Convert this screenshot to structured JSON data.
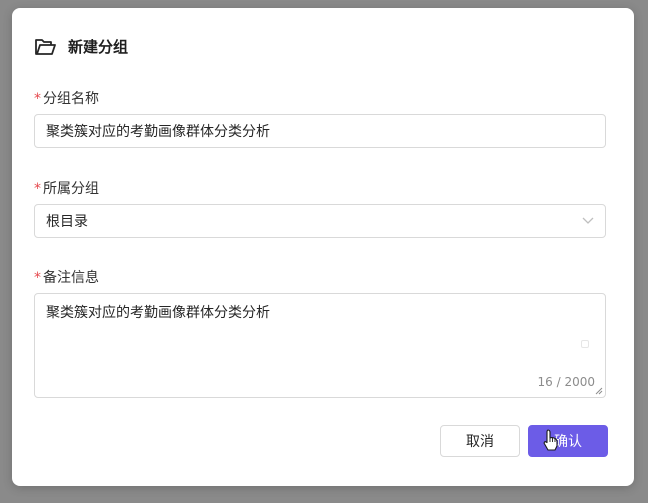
{
  "dialog": {
    "title": "新建分组",
    "title_icon": "folder-open-icon"
  },
  "fields": {
    "name": {
      "required_mark": "*",
      "label": "分组名称",
      "value": "聚类簇对应的考勤画像群体分类分析"
    },
    "parent": {
      "required_mark": "*",
      "label": "所属分组",
      "value": "根目录",
      "icon": "chevron-down-icon"
    },
    "remark": {
      "required_mark": "*",
      "label": "备注信息",
      "value": "聚类簇对应的考勤画像群体分类分析",
      "counter": "16 / 2000"
    }
  },
  "buttons": {
    "cancel": "取消",
    "confirm": "确认"
  },
  "colors": {
    "primary": "#6c5ce7",
    "required": "#e5484d",
    "border": "#d9d9d9"
  }
}
